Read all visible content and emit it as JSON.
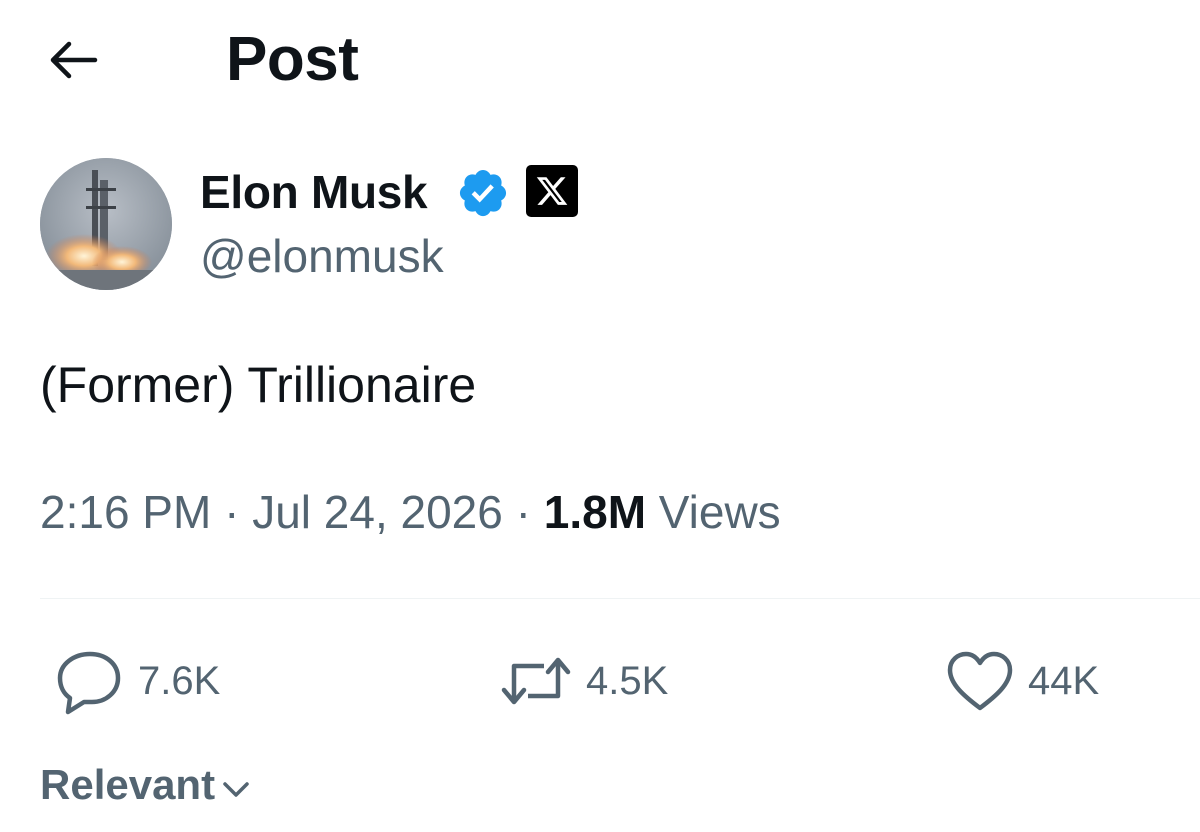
{
  "header": {
    "back_icon": "arrow-left-icon",
    "title": "Post"
  },
  "author": {
    "name": "Elon Musk",
    "handle": "@elonmusk",
    "verified_icon": "verified-badge-icon",
    "affiliation_icon": "x-logo-icon",
    "verified_color": "#1d9bf0"
  },
  "post": {
    "text": "(Former) Trillionaire",
    "time": "2:16 PM",
    "date": "Jul 24, 2026",
    "views_count": "1.8M",
    "views_label": "Views",
    "separator": "·"
  },
  "actions": {
    "reply": {
      "icon": "reply-bubble-icon",
      "count": "7.6K"
    },
    "repost": {
      "icon": "repost-icon",
      "count": "4.5K"
    },
    "like": {
      "icon": "heart-icon",
      "count": "44K"
    }
  },
  "sort": {
    "label": "Relevant",
    "icon": "chevron-down-icon"
  },
  "colors": {
    "text_primary": "#0f1419",
    "text_secondary": "#536471",
    "divider": "#eff3f4"
  }
}
